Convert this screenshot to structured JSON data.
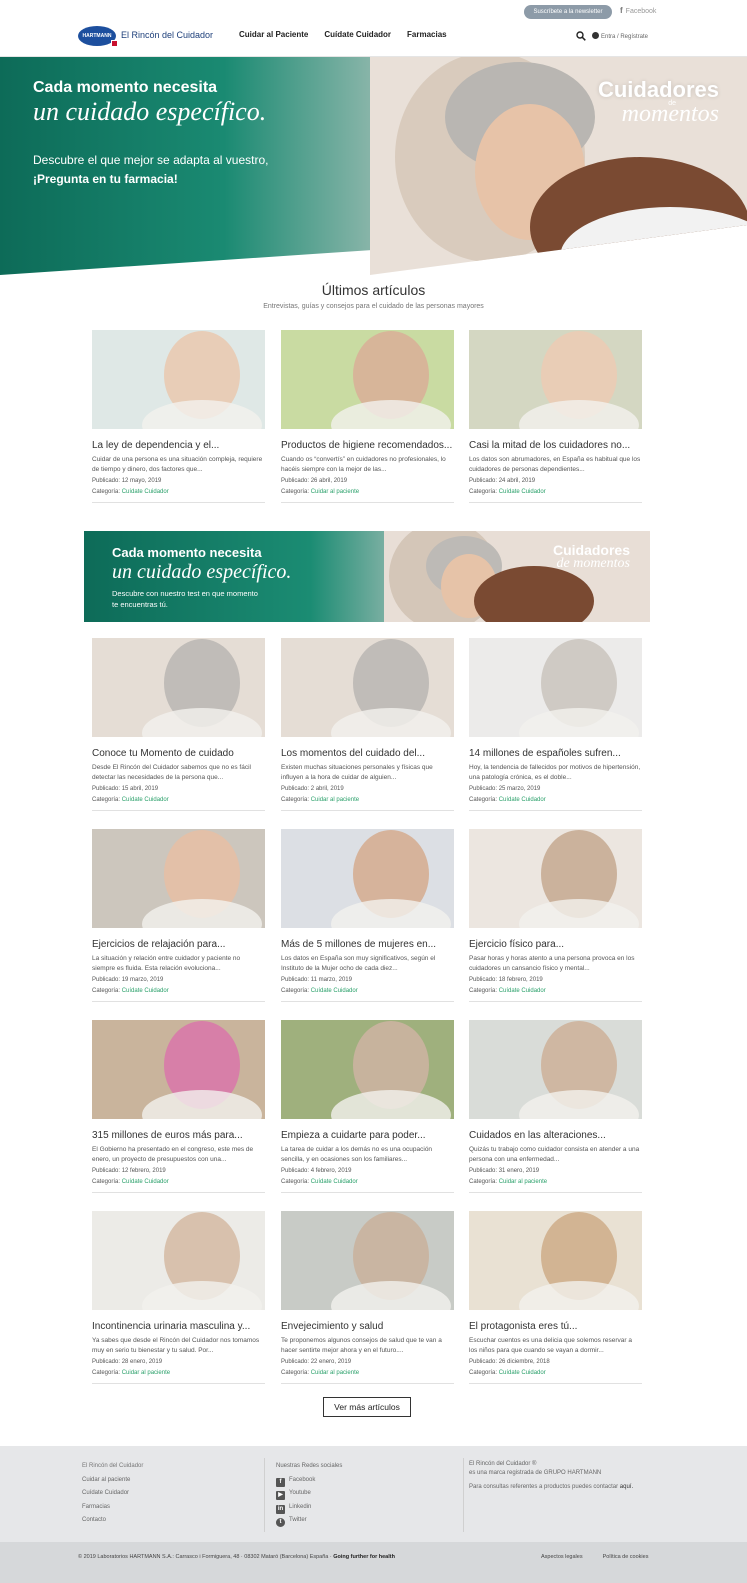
{
  "header": {
    "newsletter": "Suscríbete a la newsletter",
    "facebook": "Facebook",
    "logo_text": "HARTMANN",
    "brand": "El Rincón del Cuidador",
    "nav": [
      "Cuidar al Paciente",
      "Cuídate Cuidador",
      "Farmacias"
    ],
    "login": "Entra / Regístrate"
  },
  "hero": {
    "line1": "Cada momento necesita",
    "line2": "un cuidado específico.",
    "line3": "Descubre el que mejor se adapta al vuestro,",
    "line4": "¡Pregunta en tu farmacia!",
    "badge_top": "Cuidadores",
    "badge_de": "de",
    "badge_bottom": "momentos"
  },
  "latest": {
    "title": "Últimos artículos",
    "subtitle": "Entrevistas, guías y consejos para el cuidado de las personas mayores"
  },
  "labels": {
    "published": "Publicado:",
    "category": "Categoría:"
  },
  "cards_top": [
    {
      "title": "La ley de dependencia y el...",
      "desc": "Cuidar de una persona es una situación compleja, requiere de tiempo y dinero, dos factores que...",
      "date": "12 mayo, 2019",
      "category": "Cuídate Cuidador"
    },
    {
      "title": "Productos de higiene recomendados...",
      "desc": "Cuando os “convertís” en cuidadores no profesionales, lo hacéis siempre con la mejor de las...",
      "date": "26 abril, 2019",
      "category": "Cuidar al paciente"
    },
    {
      "title": "Casi la mitad de los cuidadores no...",
      "desc": "Los datos son abrumadores, en España es habitual que los cuidadores de personas dependientes...",
      "date": "24 abril, 2019",
      "category": "Cuídate Cuidador"
    }
  ],
  "banner": {
    "line1": "Cada momento necesita",
    "line2": "un cuidado específico.",
    "line3": "Descubre con nuestro test en que momento",
    "line4": "te encuentras tú.",
    "badge_top": "Cuidadores",
    "badge_bottom": "de momentos"
  },
  "cards_bottom": [
    {
      "title": "Conoce tu Momento de cuidado",
      "desc": "Desde El Rincón del Cuidador sabemos que no es fácil detectar las necesidades de la persona que...",
      "date": "15 abril, 2019",
      "category": "Cuídate Cuidador"
    },
    {
      "title": "Los momentos del cuidado del...",
      "desc": "Existen muchas situaciones personales y físicas que influyen a la hora de cuidar de alguien...",
      "date": "2 abril, 2019",
      "category": "Cuidar al paciente"
    },
    {
      "title": "14 millones de españoles sufren...",
      "desc": "Hoy, la tendencia de fallecidos por motivos de hipertensión, una patología crónica, es el doble...",
      "date": "25 marzo, 2019",
      "category": "Cuídate Cuidador"
    },
    {
      "title": "Ejercicios de relajación para...",
      "desc": "La situación y relación entre cuidador y paciente no siempre es fluida. Esta relación evoluciona...",
      "date": "19 marzo, 2019",
      "category": "Cuídate Cuidador"
    },
    {
      "title": "Más de 5 millones de mujeres en...",
      "desc": "Los datos en España son muy significativos, según el Instituto de la Mujer ocho de cada diez...",
      "date": "11 marzo, 2019",
      "category": "Cuídate Cuidador"
    },
    {
      "title": "Ejercicio físico para...",
      "desc": "Pasar horas y horas atento a una persona provoca en los cuidadores un cansancio físico y mental...",
      "date": "18 febrero, 2019",
      "category": "Cuídate Cuidador"
    },
    {
      "title": "315 millones de euros más para...",
      "desc": "El Gobierno ha presentado en el congreso, este mes de enero, un proyecto de presupuestos con una...",
      "date": "12 febrero, 2019",
      "category": "Cuídate Cuidador"
    },
    {
      "title": "Empieza a cuidarte para poder...",
      "desc": "La tarea de cuidar a los demás no es una ocupación sencilla, y en ocasiones son los familiares...",
      "date": "4 febrero, 2019",
      "category": "Cuídate Cuidador"
    },
    {
      "title": "Cuidados en las alteraciones...",
      "desc": "Quizás tu trabajo como cuidador consista en atender a una persona con una enfermedad...",
      "date": "31 enero, 2019",
      "category": "Cuidar al paciente"
    },
    {
      "title": "Incontinencia urinaria masculina y...",
      "desc": "Ya sabes que desde el Rincón del Cuidador nos tomamos muy en serio tu bienestar y tu salud. Por...",
      "date": "28 enero, 2019",
      "category": "Cuidar al paciente"
    },
    {
      "title": "Envejecimiento y salud",
      "desc": "Te proponemos algunos consejos de salud que te van a hacer sentirte mejor ahora y en el futuro....",
      "date": "22 enero, 2019",
      "category": "Cuidar al paciente"
    },
    {
      "title": "El protagonista eres tú...",
      "desc": "Escuchar cuentos es una delicia que solemos reservar a los niños para que cuando se vayan a dormir...",
      "date": "26 diciembre, 2018",
      "category": "Cuídate Cuidador"
    }
  ],
  "more_button": "Ver más artículos",
  "footer": {
    "col1": [
      "El Rincón del Cuidador",
      "Cuidar al paciente",
      "Cuídate Cuidador",
      "Farmacias",
      "Contacto"
    ],
    "social_title": "Nuestras Redes sociales",
    "social": [
      "Facebook",
      "Youtube",
      "Linkedin",
      "Twitter"
    ],
    "col3_line1": "El Rincón del Cuidador ®",
    "col3_line2": "es una marca registrada de GRUPO HARTMANN",
    "col3_line3": "Para consultas referentes a productos puedes contactar",
    "col3_link": "aquí.",
    "copyright": "© 2019 Laboratorios HARTMANN S.A.: Carrasco i Formiguera, 48 · 08302 Mataró (Barcelona) España ·",
    "slogan": "Going further for health",
    "legal": [
      "Aspectos legales",
      "Política de cookies"
    ]
  }
}
